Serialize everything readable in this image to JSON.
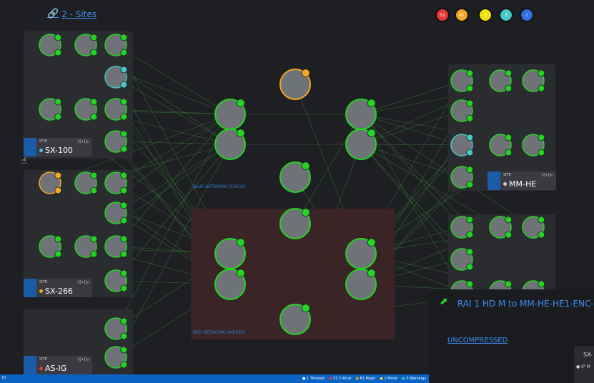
{
  "header": {
    "title": "2 - Sites",
    "title_icon": "link-icon"
  },
  "status_counts": [
    {
      "label": "51",
      "color": "#e53935"
    },
    {
      "label": "81",
      "color": "#f5a623"
    },
    {
      "label": "1",
      "color": "#f1e20b"
    },
    {
      "label": "3",
      "color": "#47c7c6"
    },
    {
      "label": "1",
      "color": "#2f6fe0"
    }
  ],
  "sites": [
    {
      "small": "SITE",
      "name": "SX-100",
      "dot_color": "#47c7f0"
    },
    {
      "small": "SITE",
      "name": "SX-266",
      "dot_color": "#f5a623"
    },
    {
      "small": "SITE",
      "name": "AS-IG",
      "dot_color": "#e53935"
    },
    {
      "small": "SITE",
      "name": "MM-HE",
      "dot_color": "#cccccc"
    }
  ],
  "networks": {
    "blue": "BLUE NETWORK (CISCO)",
    "red": "RED NETWORK (ARISTA)"
  },
  "alarm": {
    "title": "RAI 1 HD M to MM-HE-HE1-ENC-M",
    "link": "UNCOMPRESSED"
  },
  "card": {
    "title": "SX-",
    "item": "IP M"
  },
  "statusbar": {
    "left": "0)",
    "items": [
      "1 Timeout",
      "51 Critical",
      "81 Major",
      "1 Minor",
      "3 Warnings"
    ]
  },
  "colors": {
    "healthy": "#22d522",
    "warning": "#f5a623",
    "info": "#47c7c6",
    "link_line": "#3f9a3f"
  }
}
